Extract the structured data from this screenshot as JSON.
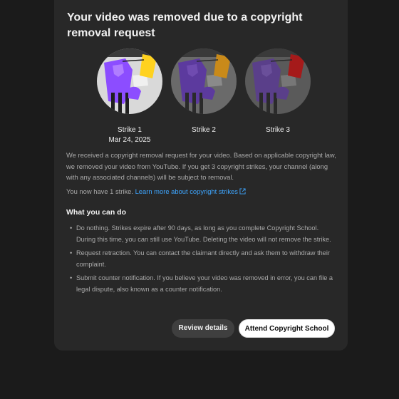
{
  "dialog": {
    "title": "Your video was removed due to a copyright removal request",
    "strikes": [
      {
        "label": "Strike 1",
        "date": "Mar 24, 2025",
        "active": true
      },
      {
        "label": "Strike 2",
        "date": "",
        "active": false
      },
      {
        "label": "Strike 3",
        "date": "",
        "active": false
      }
    ],
    "paragraph1": "We received a copyright removal request for your video. Based on applicable copyright law, we removed your video from YouTube. If you get 3 copyright strikes, your channel (along with any associated channels) will be subject to removal.",
    "strike_count_text": "You now have 1 strike.",
    "learn_more_link": "Learn more about copyright strikes",
    "section_title": "What you can do",
    "options": [
      "Do nothing. Strikes expire after 90 days, as long as you complete Copyright School. During this time, you can still use YouTube. Deleting the video will not remove the strike.",
      "Request retraction. You can contact the claimant directly and ask them to withdraw their complaint.",
      "Submit counter notification. If you believe your video was removed in error, you can file a legal dispute, also known as a counter notification."
    ],
    "buttons": {
      "review": "Review details",
      "school": "Attend Copyright School"
    }
  },
  "colors": {
    "background": "#1b1b1b",
    "dialog": "#282828",
    "link": "#3ea6ff",
    "strike_active_figure": "#8c4dff",
    "strike_active_card": "#ffd21f",
    "strike2_card": "#c98a1a",
    "strike3_card": "#a51a1a"
  },
  "icons": [
    "referee-strike-illustration",
    "external-link-icon"
  ]
}
